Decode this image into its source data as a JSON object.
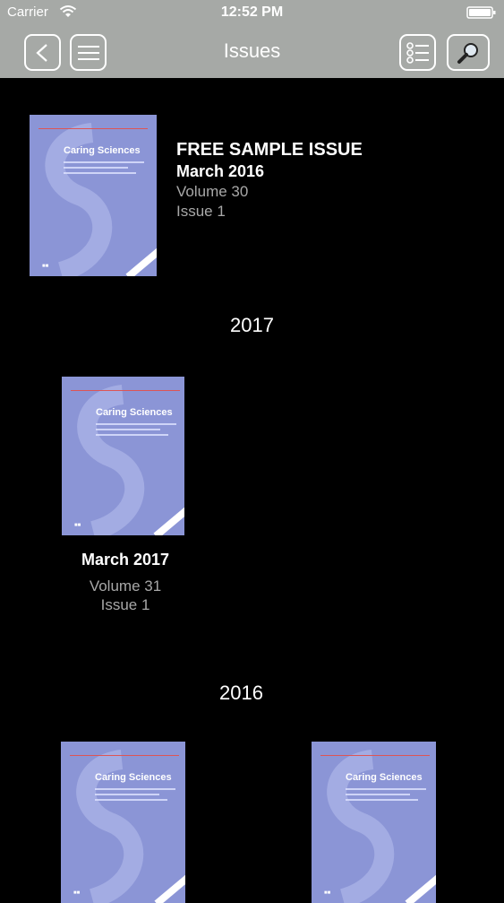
{
  "status_bar": {
    "carrier": "Carrier",
    "time": "12:52 PM"
  },
  "nav": {
    "title": "Issues",
    "back_icon": "chevron-left-icon",
    "menu_icon": "hamburger-menu-icon",
    "list_icon": "list-icon",
    "search_icon": "magnifier-icon"
  },
  "cover": {
    "journal_title": "Caring Sciences"
  },
  "featured": {
    "label": "FREE SAMPLE ISSUE",
    "date": "March 2016",
    "volume": "Volume 30",
    "issue": "Issue 1"
  },
  "sections": [
    {
      "year": "2017",
      "issues": [
        {
          "date": "March 2017",
          "volume": "Volume 31",
          "issue": "Issue 1"
        }
      ]
    },
    {
      "year": "2016",
      "issues": [
        {
          "date": "",
          "volume": "",
          "issue": ""
        },
        {
          "date": "",
          "volume": "",
          "issue": ""
        }
      ]
    }
  ],
  "colors": {
    "bar": "#a6a9a6",
    "background": "#000000",
    "cover": "#8b95d6",
    "secondary_text": "#a8a8a8"
  }
}
